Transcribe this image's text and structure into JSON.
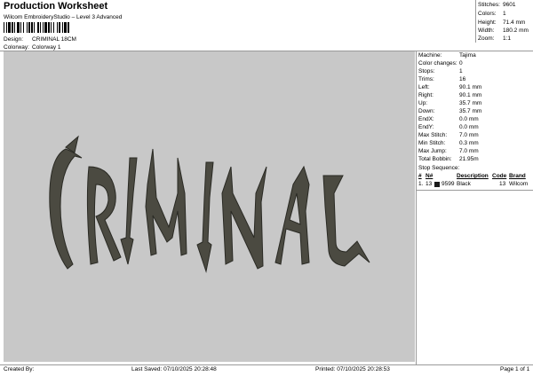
{
  "header": {
    "title": "Production Worksheet",
    "subtitle": "Wilcom EmbroideryStudio – Level 3 Advanced",
    "design_label": "Design:",
    "design_value": "CRIMINAL 18CM",
    "colorway_label": "Colorway:",
    "colorway_value": "Colorway 1"
  },
  "stats": [
    {
      "label": "Stitches:",
      "value": "9601"
    },
    {
      "label": "Colors:",
      "value": "1"
    },
    {
      "label": "Height:",
      "value": "71.4 mm"
    },
    {
      "label": "Width:",
      "value": "180.2 mm"
    },
    {
      "label": "Zoom:",
      "value": "1:1"
    }
  ],
  "design": {
    "text": "CRIMINAL",
    "thread_color": "#4b4a41",
    "background": "#c8c8c8"
  },
  "machine_info": [
    {
      "label": "Machine:",
      "value": "Tajima"
    },
    {
      "label": "Color changes:",
      "value": "0"
    },
    {
      "label": "Stops:",
      "value": "1"
    },
    {
      "label": "Trims:",
      "value": "16"
    },
    {
      "label": "Left:",
      "value": "90.1 mm"
    },
    {
      "label": "Right:",
      "value": "90.1 mm"
    },
    {
      "label": "Up:",
      "value": "35.7 mm"
    },
    {
      "label": "Down:",
      "value": "35.7 mm"
    },
    {
      "label": "EndX:",
      "value": "0.0 mm"
    },
    {
      "label": "EndY:",
      "value": "0.0 mm"
    },
    {
      "label": "Max Stitch:",
      "value": "7.0 mm"
    },
    {
      "label": "Min Stitch:",
      "value": "0.3 mm"
    },
    {
      "label": "Max Jump:",
      "value": "7.0 mm"
    },
    {
      "label": "Total Bobbin:",
      "value": "21.95m"
    }
  ],
  "stop_sequence": {
    "title": "Stop Sequence:",
    "headers": {
      "num": "#",
      "n": "N#",
      "desc": "Description",
      "code": "Code",
      "brand": "Brand"
    },
    "rows": [
      {
        "stop": "1.",
        "n": "13",
        "swatch_color": "#1a1a1a",
        "code_num": "9599",
        "desc": "Black",
        "code": "13",
        "brand": "Wilcom"
      }
    ]
  },
  "footer": {
    "created_by": "Created By:",
    "last_saved": "Last Saved: 07/10/2025 20:28:48",
    "printed": "Printed: 07/10/2025 20:28:53",
    "page": "Page 1 of 1"
  }
}
